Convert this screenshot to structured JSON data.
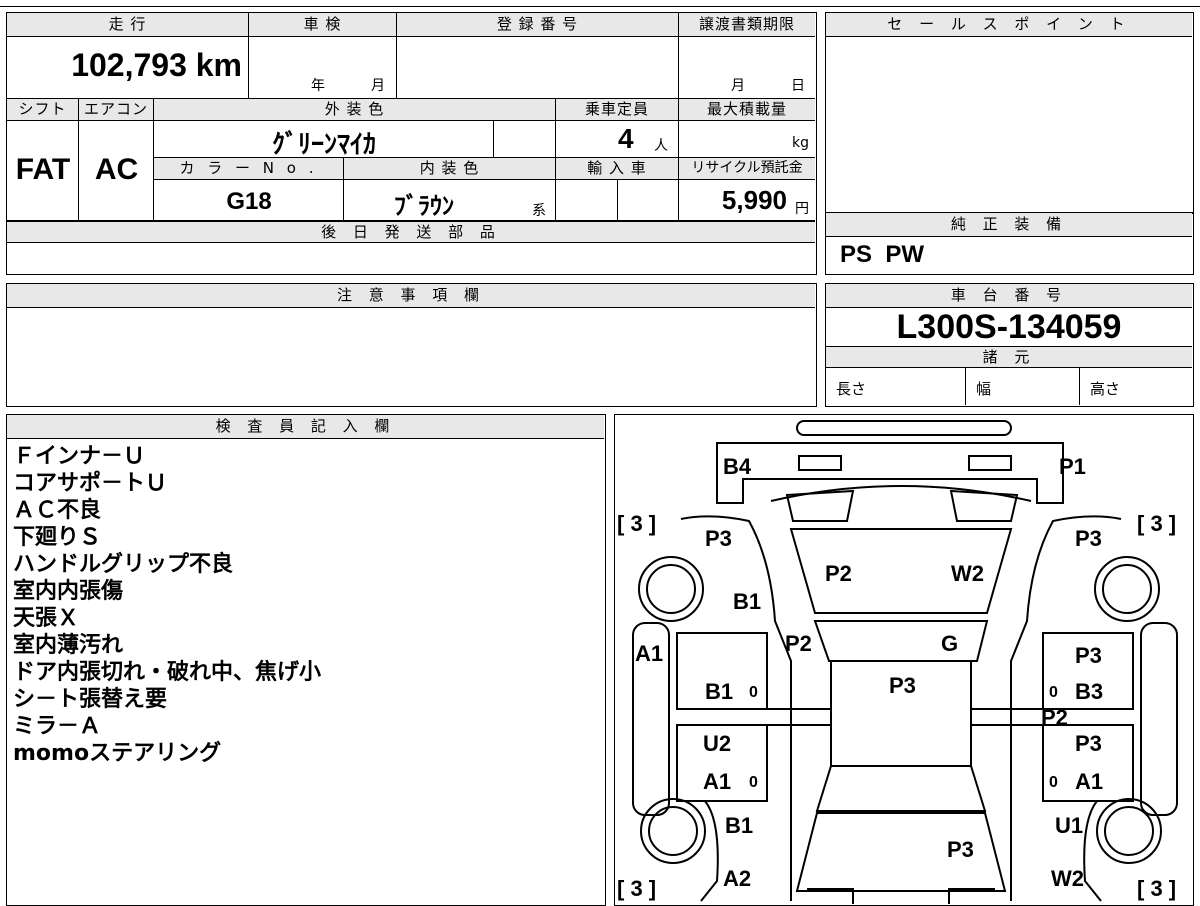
{
  "vehicle": {
    "labels": {
      "mileage": "走 行",
      "inspection": "車 検",
      "registration": "登 録 番 号",
      "transfer_deadline": "譲渡書類期限",
      "shift": "シフト",
      "aircon": "エアコン",
      "exterior_color": "外 装 色",
      "capacity": "乗車定員",
      "max_load": "最大積載量",
      "color_no": "カ ラ ー N o .",
      "interior_color": "内 装 色",
      "import": "輸 入 車",
      "recycle": "リサイクル預託金",
      "year": "年",
      "month": "月",
      "day": "日",
      "person": "人",
      "kg": "kg",
      "yen": "円",
      "kei": "系"
    },
    "mileage": "102,793 km",
    "shift": "FAT",
    "aircon": "AC",
    "exterior_color": "ｸﾞﾘｰﾝﾏｲｶ",
    "capacity": "4",
    "color_no": "G18",
    "interior_color": "ﾌﾞﾗｳﾝ",
    "recycle_fee": "5,990"
  },
  "sales_point": {
    "label": "セ ー ル ス ポ イ ン ト"
  },
  "later_parts": {
    "label": "後 日 発 送 部 品"
  },
  "standard_equipment": {
    "label": "純 正 装 備",
    "value": "PS  PW"
  },
  "notes": {
    "label": "注 意 事 項 欄"
  },
  "chassis": {
    "label": "車 台 番 号",
    "number": "L300S-134059"
  },
  "specs": {
    "label": "諸 元",
    "length": "長さ",
    "width": "幅",
    "height": "高さ"
  },
  "inspector": {
    "label": "検 査 員 記 入 欄",
    "lines": [
      "Ｆインナ－Ｕ",
      "コアサポ－トＵ",
      "ＡＣ不良",
      "下廻りＳ",
      "ハンドルグリップ不良",
      "室内内張傷",
      "天張Ｘ",
      "室内薄汚れ",
      "ドア内張切れ・破れ中、焦げ小",
      "シ－ト張替え要",
      "ミラ－Ａ",
      "momoステアリング"
    ]
  },
  "diagram": {
    "marks": {
      "b4": "B4",
      "p1": "P1",
      "p3_fl": "P3",
      "p3_fr": "P3",
      "p2_hood": "P2",
      "w2_hood": "W2",
      "b1_fl": "B1",
      "a1_left": "A1",
      "p2_center": "P2",
      "g_center": "G",
      "p3_roof": "P3",
      "b1_ld": "B1",
      "zero_1": "0",
      "p3_rd1": "P3",
      "zero_2": "0",
      "b3_rd": "B3",
      "p2_rd": "P2",
      "u2_ld": "U2",
      "p3_rd2": "P3",
      "a1_ld": "A1",
      "zero_3": "0",
      "zero_4": "0",
      "a1_rd": "A1",
      "b1_rl": "B1",
      "u1_rr": "U1",
      "p3_rear": "P3",
      "a2_rl": "A2",
      "w2_rr": "W2",
      "br_fl": "[ 3 ]",
      "br_fr": "[ 3 ]",
      "br_rl": "[ 3 ]",
      "br_rr": "[ 3 ]"
    }
  }
}
